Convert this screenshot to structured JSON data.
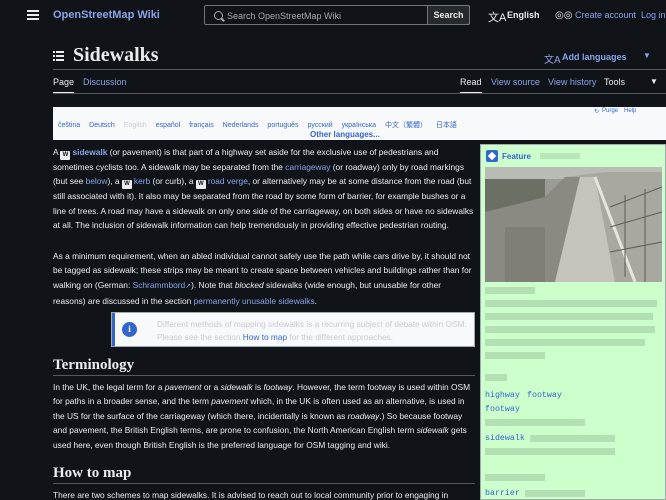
{
  "header": {
    "site_title": "OpenStreetMap Wiki",
    "search_placeholder": "Search OpenStreetMap Wiki",
    "search_button": "Search",
    "language": "English",
    "create_account": "Create account",
    "login": "Log in"
  },
  "page": {
    "title": "Sidewalks",
    "add_languages": "Add languages"
  },
  "tabs": {
    "left": [
      "Page",
      "Discussion"
    ],
    "right": [
      "Read",
      "View source",
      "View history",
      "Tools"
    ],
    "active_left": "Page",
    "active_right": "Read"
  },
  "langbar": {
    "purge": "Purge",
    "help": "Help",
    "languages": [
      "čeština",
      "Deutsch",
      "English",
      "español",
      "français",
      "Nederlands",
      "português",
      "русский",
      "українська",
      "中文（繁體）",
      "日本語"
    ],
    "current": "English",
    "other": "Other languages..."
  },
  "intro": {
    "p1_a": "A ",
    "sidewalk": "sidewalk",
    "p1_b": " (or pavement) is that part of a highway set aside for the exclusive use of pedestrians and sometimes cyclists too. A sidewalk may be separated from the ",
    "carriageway": "carriageway",
    "p1_c": " (or roadway) only by road markings (but see ",
    "below": "below",
    "p1_d": "), a ",
    "kerb": "kerb",
    "p1_e": " (or curb), a ",
    "road_verge": "road verge",
    "p1_f": ", or alternatively may be at some distance from the road (but still associated with it). It also may be separated from the road by some form of barrier, for example bushes or a line of trees. A road may have a sidewalk on only one side of the carriageway, on both sides or have no sidewalks at all. The inclusion of sidewalk information can help tremendously in providing effective pedestrian routing.",
    "p2_a": "As a minimum requirement, when an abled individual cannot safely use the path while cars drive by, it should not be tagged as sidewalk; these strips may be meant to create space between vehicles and buildings rather than for walking on (German: ",
    "schrammbord": "Schrammbord",
    "p2_b": "). Note that ",
    "blocked": "blocked",
    "p2_c": " sidewalks (wide enough, but unusable for other reasons) are discussed in the section ",
    "unusable": "permanently unusable sidewalks",
    "p2_d": "."
  },
  "notice": {
    "text_a": "Different methods of mapping sidewalks is a recurring subject of debate within OSM. Please see the section ",
    "link": "How to map",
    "text_b": " for the different approaches."
  },
  "terminology": {
    "heading": "Terminology",
    "a": "In the UK, the legal term for a ",
    "pavement": "pavement",
    "b": " or a ",
    "sidewalk": "sidewalk",
    "c": " is ",
    "footway": "footway",
    "d": ". However, the term footway is used within OSM for paths in a broader sense, and the term ",
    "pavement2": "pavement",
    "e": " which, in the UK is often used as an alternative, is used in the US for the surface of the carriageway (which there, incidentally is known as ",
    "roadway": "roadway",
    "f": ".) So because footway and pavement, the British English terms, are prone to confusion, the North American English term ",
    "sidewalk2": "sidewalk",
    "g": " gets used here, even though British English is the preferred language for OSM tagging and wiki."
  },
  "how_to_map": {
    "heading": "How to map",
    "text": "There are two schemes to map sidewalks. It is advised to reach out to local community prior to engaging in"
  },
  "infobox": {
    "feature": "Feature",
    "keys": [
      "highway",
      "footway",
      "sidewalk",
      "barrier"
    ],
    "colors": {
      "bg": "#ccffcc",
      "link": "#3366cc"
    }
  }
}
